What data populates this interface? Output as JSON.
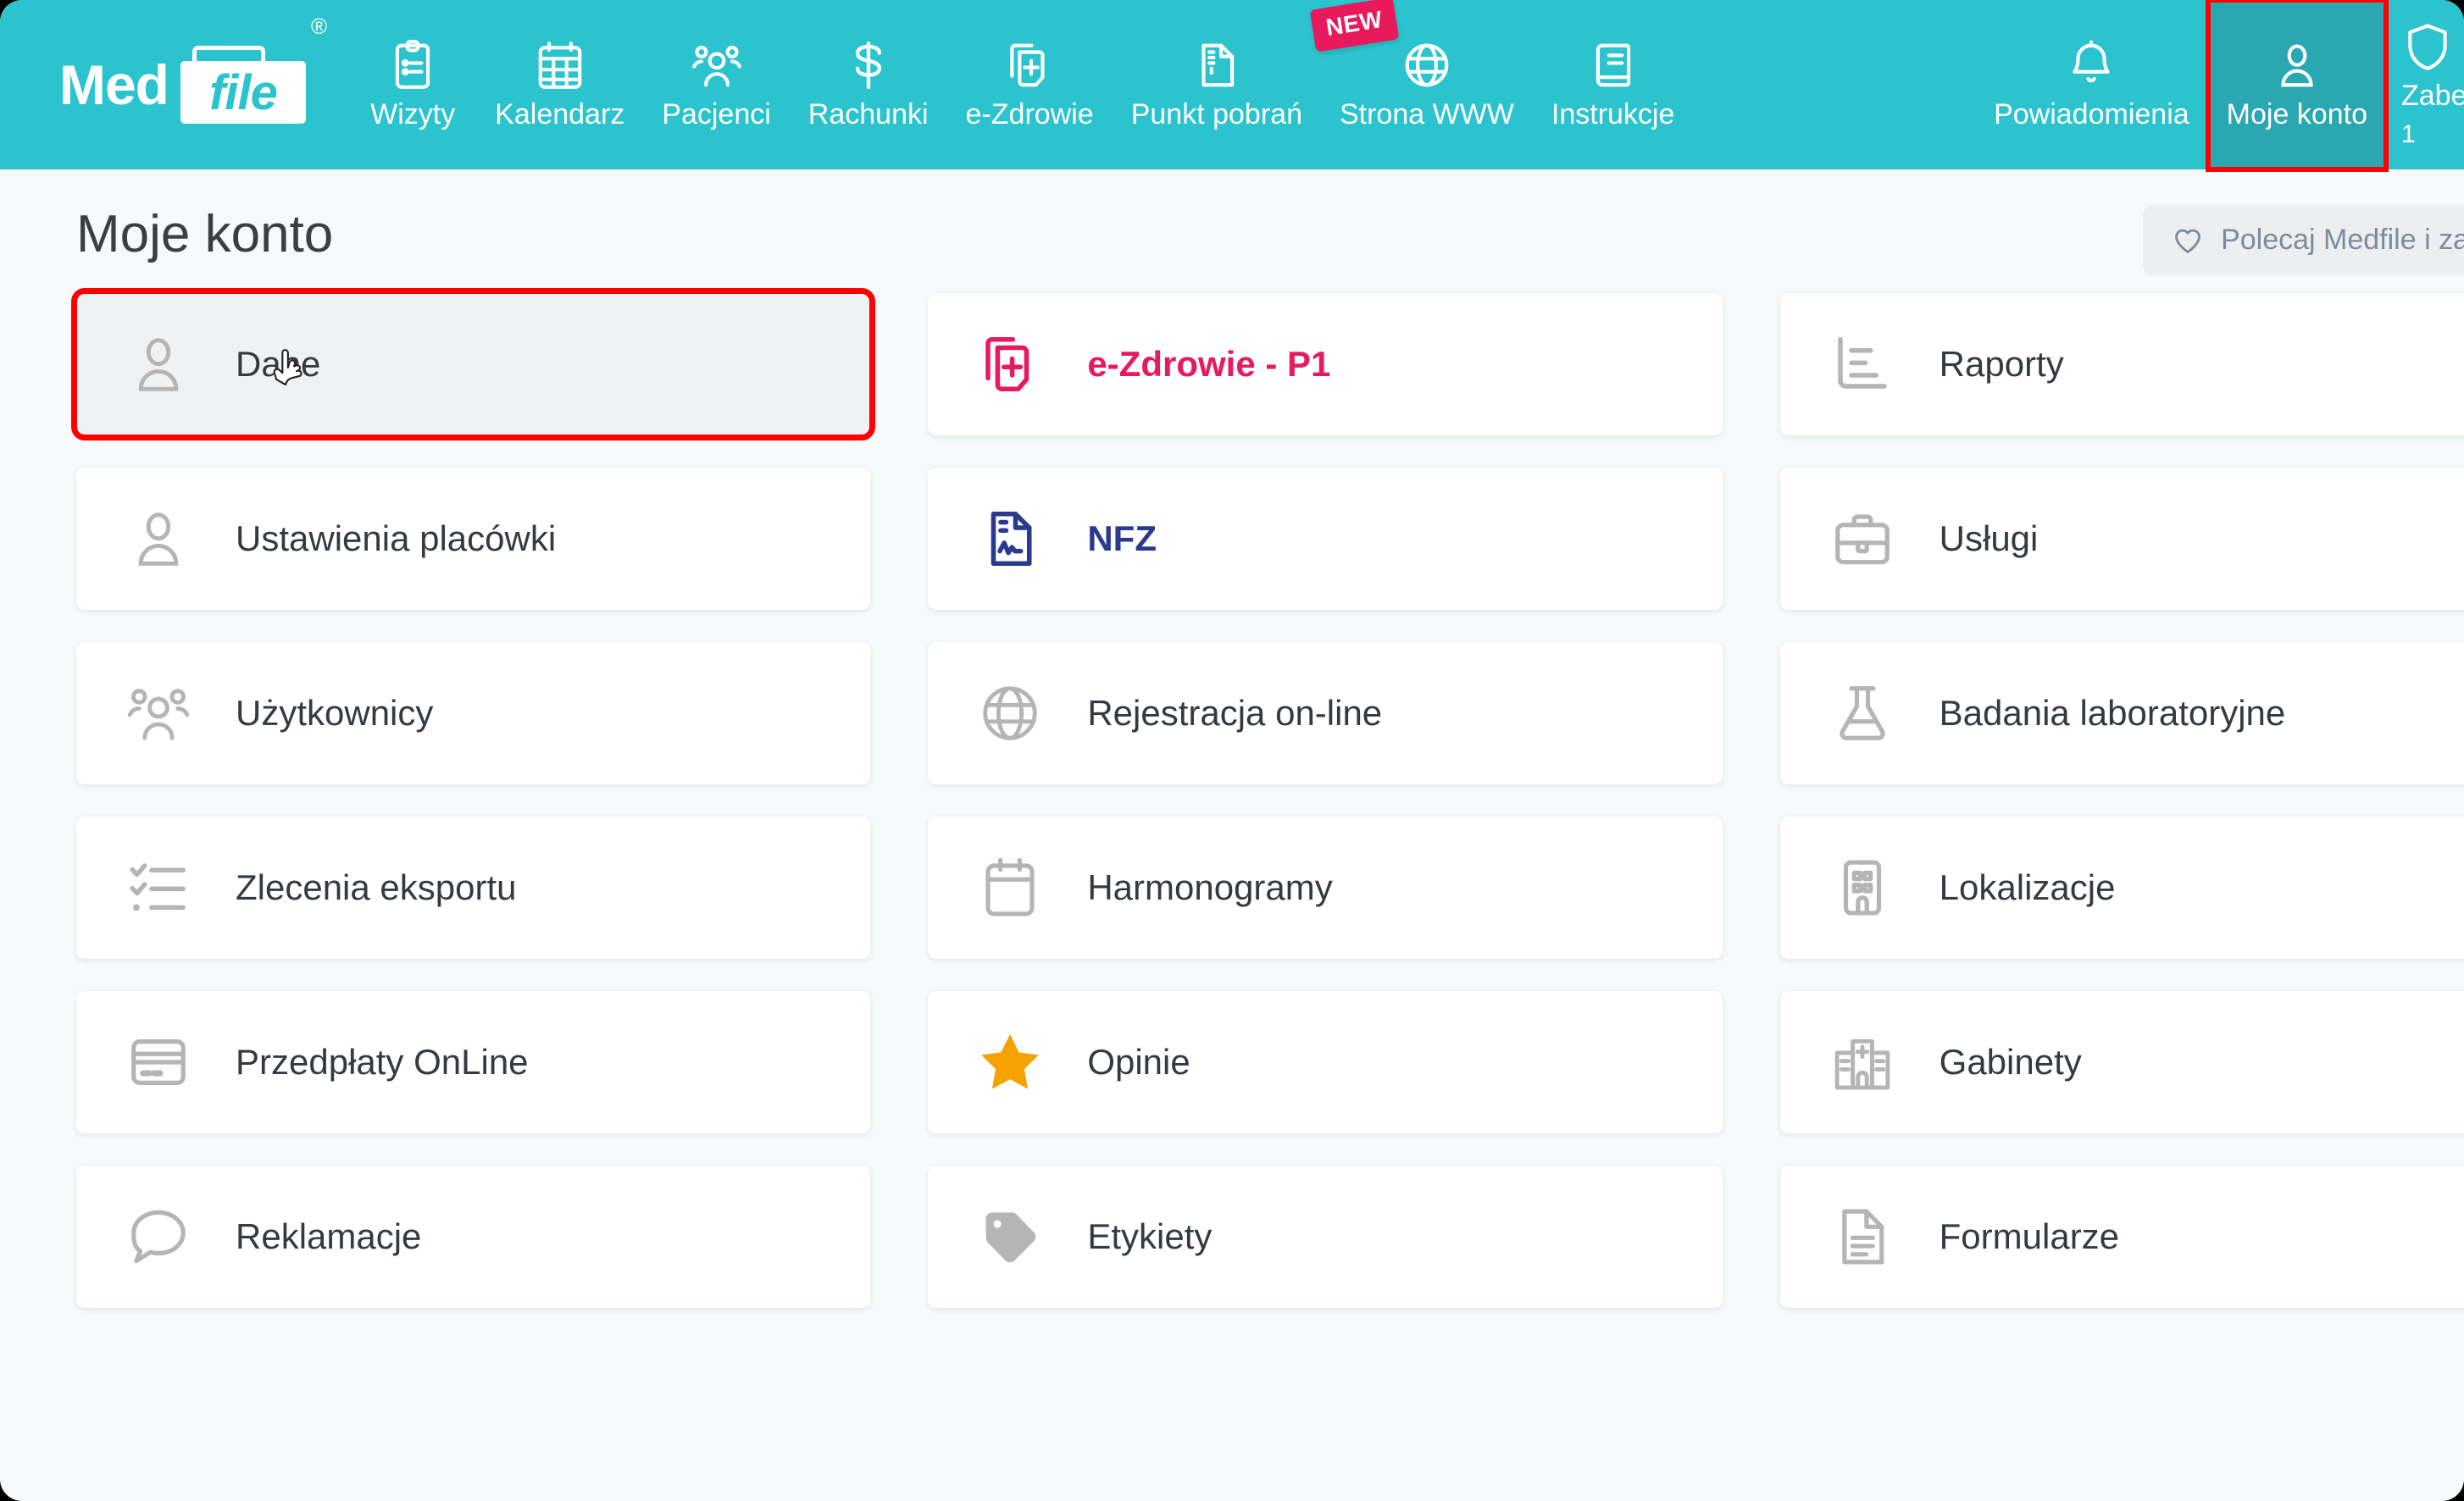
{
  "brand": {
    "med": "Med",
    "file": "file",
    "registered": "®"
  },
  "colors": {
    "teal": "#2bc4ce",
    "teal_active": "#29a8b2",
    "pink": "#e8195c",
    "navy": "#2a3b8f",
    "star_orange": "#f5a100",
    "highlight_red": "#ff0000",
    "page_bg": "#f6fafb"
  },
  "topnav": {
    "items": [
      {
        "label": "Wizyty",
        "icon": "clipboard-icon",
        "active": false
      },
      {
        "label": "Kalendarz",
        "icon": "calendar-icon",
        "active": false
      },
      {
        "label": "Pacjenci",
        "icon": "users-icon",
        "active": false
      },
      {
        "label": "Rachunki",
        "icon": "dollar-icon",
        "active": false
      },
      {
        "label": "e-Zdrowie",
        "icon": "medical-file-icon",
        "active": false
      },
      {
        "label": "Punkt pobrań",
        "icon": "document-icon",
        "active": false
      },
      {
        "label": "Strona WWW",
        "icon": "globe-icon",
        "active": false,
        "badge": "NEW"
      },
      {
        "label": "Instrukcje",
        "icon": "book-icon",
        "active": false
      }
    ],
    "right_items": [
      {
        "label": "Powiadomienia",
        "icon": "bell-icon",
        "active": false
      },
      {
        "label": "Moje konto",
        "icon": "user-icon",
        "active": true,
        "highlighted": true
      },
      {
        "label": "Zabe",
        "sublabel": "1",
        "icon": "shield-icon",
        "active": false,
        "cut": true
      }
    ]
  },
  "page": {
    "title": "Moje konto",
    "recommend_button": "Polecaj Medfile i za"
  },
  "cards": [
    {
      "label": "Dane",
      "icon": "user-icon",
      "color": "default",
      "hovered": true,
      "highlighted": true,
      "cursor": true
    },
    {
      "label": "e-Zdrowie - P1",
      "icon": "medical-file-icon",
      "color": "pink"
    },
    {
      "label": "Raporty",
      "icon": "bar-chart-icon",
      "color": "default"
    },
    {
      "label": "Ustawienia placówki",
      "icon": "user-icon",
      "color": "default"
    },
    {
      "label": "NFZ",
      "icon": "report-doc-icon",
      "color": "navy"
    },
    {
      "label": "Usługi",
      "icon": "briefcase-icon",
      "color": "default"
    },
    {
      "label": "Użytkownicy",
      "icon": "users-icon",
      "color": "default"
    },
    {
      "label": "Rejestracja on-line",
      "icon": "globe-icon",
      "color": "default"
    },
    {
      "label": "Badania laboratoryjne",
      "icon": "flask-icon",
      "color": "default"
    },
    {
      "label": "Zlecenia eksportu",
      "icon": "checklist-icon",
      "color": "default"
    },
    {
      "label": "Harmonogramy",
      "icon": "calendar-blank-icon",
      "color": "default"
    },
    {
      "label": "Lokalizacje",
      "icon": "building-icon",
      "color": "default"
    },
    {
      "label": "Przedpłaty OnLine",
      "icon": "credit-card-icon",
      "color": "default"
    },
    {
      "label": "Opinie",
      "icon": "star-icon",
      "color": "default"
    },
    {
      "label": "Gabinety",
      "icon": "hospital-icon",
      "color": "default"
    },
    {
      "label": "Reklamacje",
      "icon": "speech-bubble-icon",
      "color": "default"
    },
    {
      "label": "Etykiety",
      "icon": "tag-icon",
      "color": "default"
    },
    {
      "label": "Formularze",
      "icon": "document-lines-icon",
      "color": "default"
    }
  ]
}
